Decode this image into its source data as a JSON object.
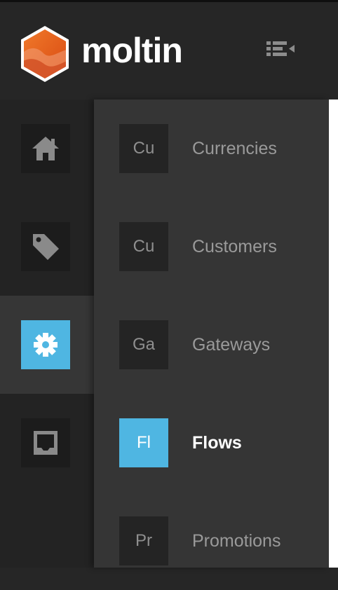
{
  "brand": {
    "name": "moltin",
    "logo_icon": "moltin-hex-logo",
    "colors": {
      "orange": "#e9641f",
      "accent": "#4fb6e2",
      "background": "#262626"
    }
  },
  "header": {
    "collapse_icon": "menu-collapse-icon"
  },
  "rail": {
    "items": [
      {
        "icon": "home-icon",
        "active": false
      },
      {
        "icon": "tag-icon",
        "active": false
      },
      {
        "icon": "gear-icon",
        "active": true
      },
      {
        "icon": "inbox-icon",
        "active": false
      }
    ]
  },
  "submenu": {
    "items": [
      {
        "abbr": "Cu",
        "label": "Currencies",
        "active": false
      },
      {
        "abbr": "Cu",
        "label": "Customers",
        "active": false
      },
      {
        "abbr": "Ga",
        "label": "Gateways",
        "active": false
      },
      {
        "abbr": "Fl",
        "label": "Flows",
        "active": true
      },
      {
        "abbr": "Pr",
        "label": "Promotions",
        "active": false
      }
    ]
  }
}
